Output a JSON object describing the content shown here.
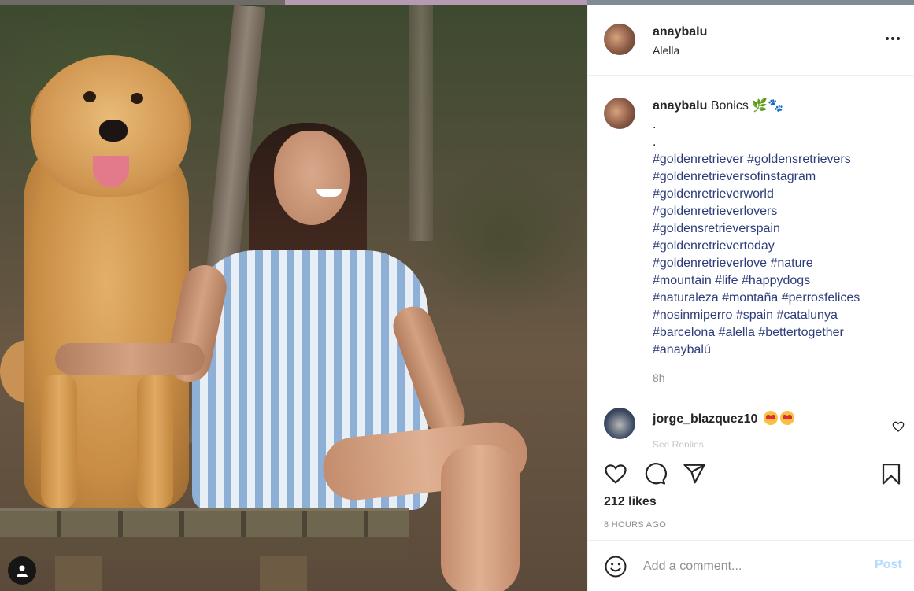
{
  "post": {
    "username": "anaybalu",
    "location": "Alella",
    "caption_text": "Bonics",
    "caption_emojis": "🌿🐾",
    "dot1": ".",
    "dot2": ".",
    "hashtags": [
      [
        "#goldenretriever",
        "#goldensretrievers"
      ],
      [
        "#goldenretrieversofinstagram"
      ],
      [
        "#goldenretrieverworld"
      ],
      [
        "#goldenretrieverlovers"
      ],
      [
        "#goldensretrieverspain"
      ],
      [
        "#goldenretrievertoday"
      ],
      [
        "#goldenretrieverlove",
        "#nature"
      ],
      [
        "#mountain",
        "#life",
        "#happydogs"
      ],
      [
        "#naturaleza",
        "#montaña",
        "#perrosfelices"
      ],
      [
        "#nosinmiperro",
        "#spain",
        "#catalunya"
      ],
      [
        "#barcelona",
        "#alella",
        "#bettertogether"
      ],
      [
        "#anaybalú"
      ]
    ],
    "time": "8h"
  },
  "comment": {
    "username": "jorge_blazquez10",
    "emoji_count": 2,
    "reply_peek": "See Replies"
  },
  "actions": {
    "likes": "212 likes",
    "timestamp": "8 HOURS AGO"
  },
  "comment_box": {
    "placeholder": "Add a comment...",
    "post_label": "Post"
  },
  "colors": {
    "hashtag": "#2c3c7a",
    "post_button": "#b3dbff",
    "muted": "#8e8e8e"
  }
}
